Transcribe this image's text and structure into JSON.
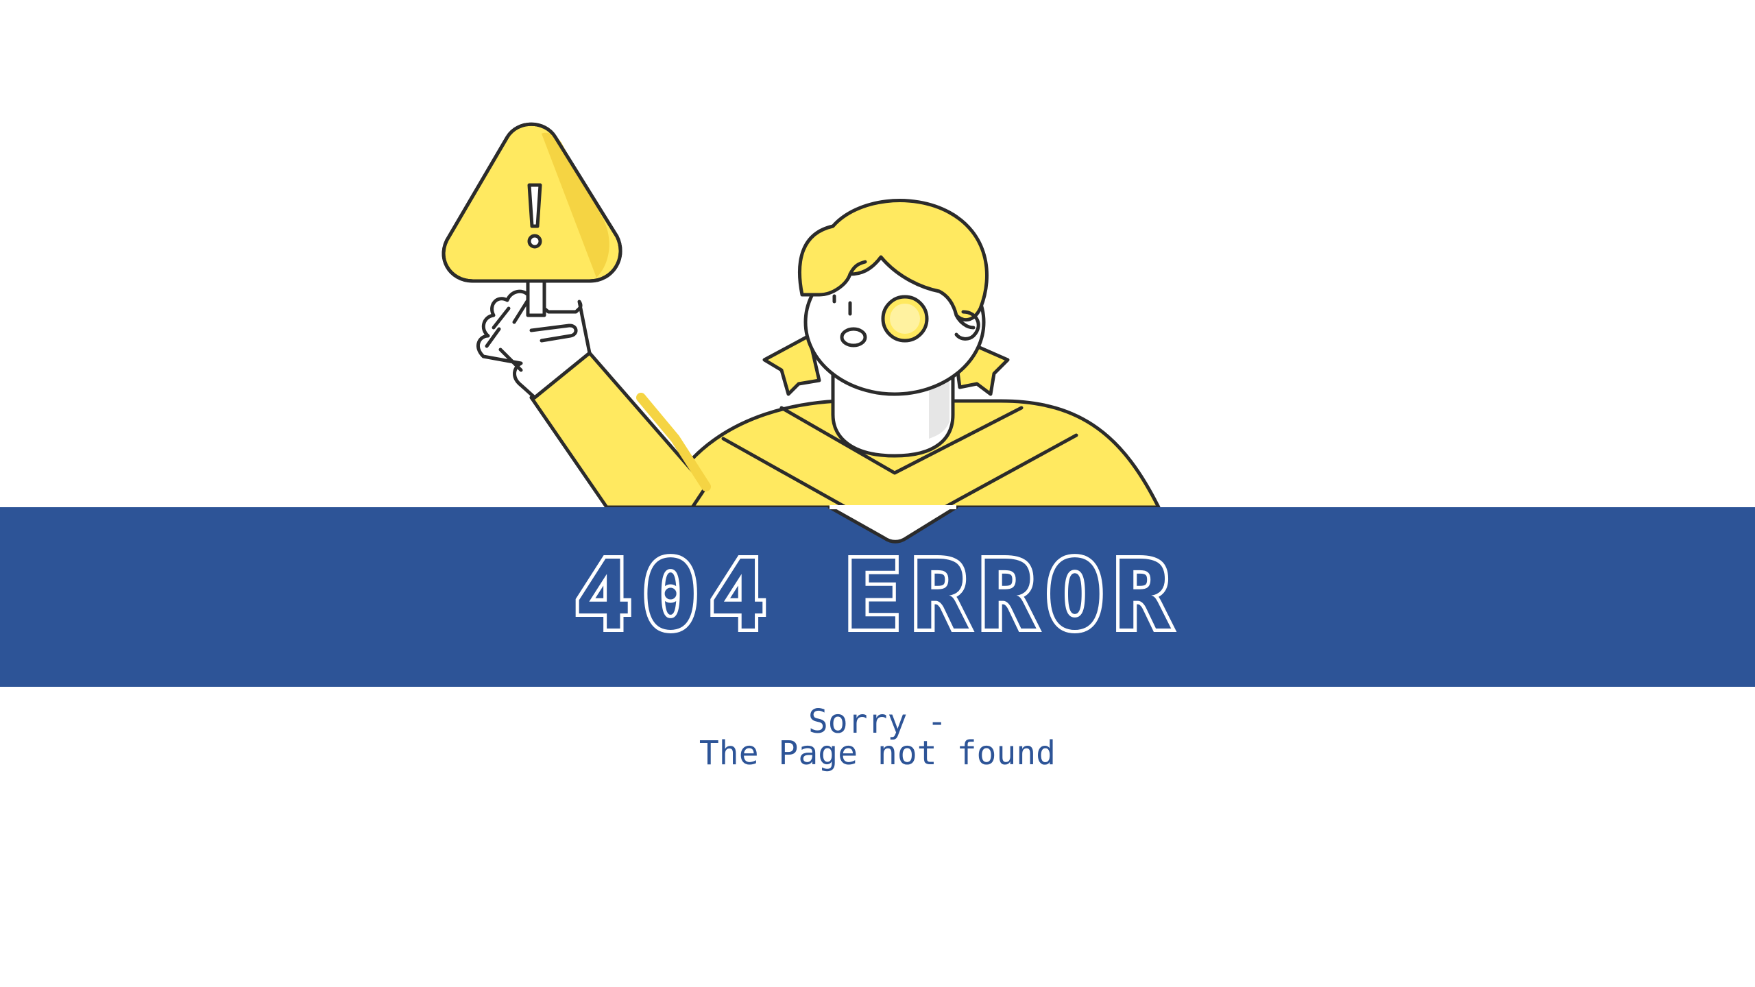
{
  "error": {
    "title": "404 ERROR",
    "message_line1": "Sorry -",
    "message_line2": "The Page not found"
  },
  "colors": {
    "banner": "#2D5497",
    "accent_yellow": "#FFE960",
    "yellow_shade": "#F5D443",
    "outline": "#2B2B2B",
    "background": "#FFFFFF",
    "text_blue": "#2D5497"
  },
  "illustration": {
    "subject": "girl-holding-warning-sign",
    "sign_icon": "exclamation-warning-icon"
  }
}
